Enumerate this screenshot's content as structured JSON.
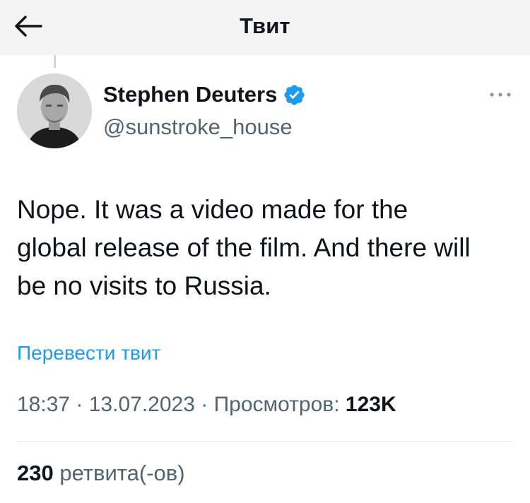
{
  "header": {
    "title": "Твит",
    "back_icon": "arrow-left-icon"
  },
  "tweet": {
    "author": {
      "name": "Stephen Deuters",
      "handle": "@sunstroke_house",
      "verified": true,
      "verified_color": "#1d9bf0"
    },
    "more_icon": "more-horizontal-icon",
    "text": "Nope. It was a video made for the\nglobal release of the film. And there will\nbe no visits to Russia.",
    "translate_label": "Перевести твит",
    "time": "18:37",
    "date": "13.07.2023",
    "views_label": "Просмотров:",
    "views_count": "123K",
    "retweets_count": "230",
    "retweets_label": "ретвита(-ов)"
  },
  "colors": {
    "accent": "#1d9bf0",
    "secondary_text": "#536471",
    "primary_text": "#0f1419",
    "header_bg": "#f4f4f4"
  }
}
